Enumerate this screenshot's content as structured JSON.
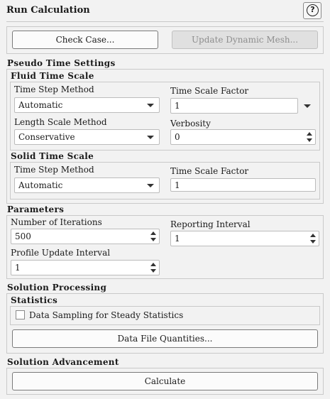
{
  "panel": {
    "title": "Run Calculation",
    "help_icon": "question-circle-icon"
  },
  "top_buttons": {
    "check_case": "Check Case...",
    "update_dynamic_mesh": "Update Dynamic Mesh..."
  },
  "pseudo_time": {
    "heading": "Pseudo Time Settings",
    "fluid": {
      "heading": "Fluid Time Scale",
      "time_step_method_label": "Time Step Method",
      "time_step_method_value": "Automatic",
      "time_scale_factor_label": "Time Scale Factor",
      "time_scale_factor_value": "1",
      "length_scale_method_label": "Length Scale Method",
      "length_scale_method_value": "Conservative",
      "verbosity_label": "Verbosity",
      "verbosity_value": "0"
    },
    "solid": {
      "heading": "Solid Time Scale",
      "time_step_method_label": "Time Step Method",
      "time_step_method_value": "Automatic",
      "time_scale_factor_label": "Time Scale Factor",
      "time_scale_factor_value": "1"
    }
  },
  "parameters": {
    "heading": "Parameters",
    "num_iterations_label": "Number of Iterations",
    "num_iterations_value": "500",
    "reporting_interval_label": "Reporting Interval",
    "reporting_interval_value": "1",
    "profile_update_label": "Profile Update Interval",
    "profile_update_value": "1"
  },
  "solution_processing": {
    "heading": "Solution Processing",
    "statistics_heading": "Statistics",
    "data_sampling_label": "Data Sampling for Steady Statistics",
    "data_sampling_checked": false,
    "data_file_quantities": "Data File Quantities..."
  },
  "solution_advancement": {
    "heading": "Solution Advancement",
    "calculate": "Calculate"
  }
}
